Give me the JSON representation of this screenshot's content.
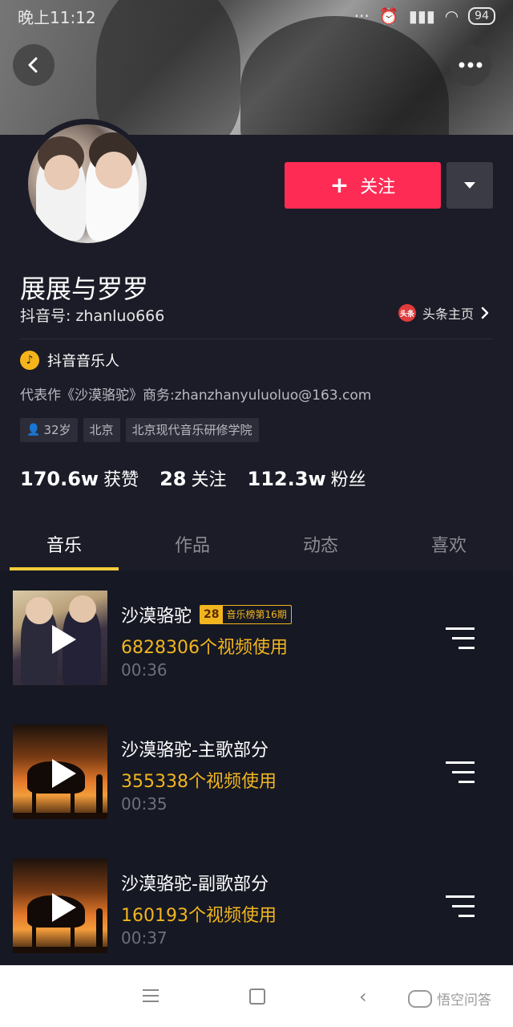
{
  "status_bar": {
    "time": "晚上11:12",
    "battery": "94"
  },
  "header": {
    "back_icon": "chevron-left-icon",
    "more_icon": "more-horizontal-icon"
  },
  "profile": {
    "name": "展展与罗罗",
    "douyin_id": "抖音号: zhanluo666",
    "follow_label": "关注",
    "toutiao_logo_text": "头条",
    "toutiao_link": "头条主页",
    "verified_label": "抖音音乐人",
    "bio": "代表作《沙漠骆驼》商务:zhanzhanyuluoluo@163.com",
    "tags": [
      "32岁",
      "北京",
      "北京现代音乐研修学院"
    ]
  },
  "stats": [
    {
      "value": "170.6w",
      "label": "获赞"
    },
    {
      "value": "28",
      "label": "关注"
    },
    {
      "value": "112.3w",
      "label": "粉丝"
    }
  ],
  "tabs": [
    "音乐",
    "作品",
    "动态",
    "喜欢"
  ],
  "active_tab": 0,
  "songs": [
    {
      "title": "沙漠骆驼",
      "badge_num": "28",
      "badge_text": "音乐榜第16期",
      "usage": "6828306个视频使用",
      "duration": "00:36"
    },
    {
      "title": "沙漠骆驼-主歌部分",
      "usage": "355338个视频使用",
      "duration": "00:35"
    },
    {
      "title": "沙漠骆驼-副歌部分",
      "usage": "160193个视频使用",
      "duration": "00:37"
    }
  ],
  "watermark": "悟空问答",
  "colors": {
    "follow_red": "#fe2c55",
    "accent_yellow": "#f1b51f",
    "background": "#161823"
  }
}
